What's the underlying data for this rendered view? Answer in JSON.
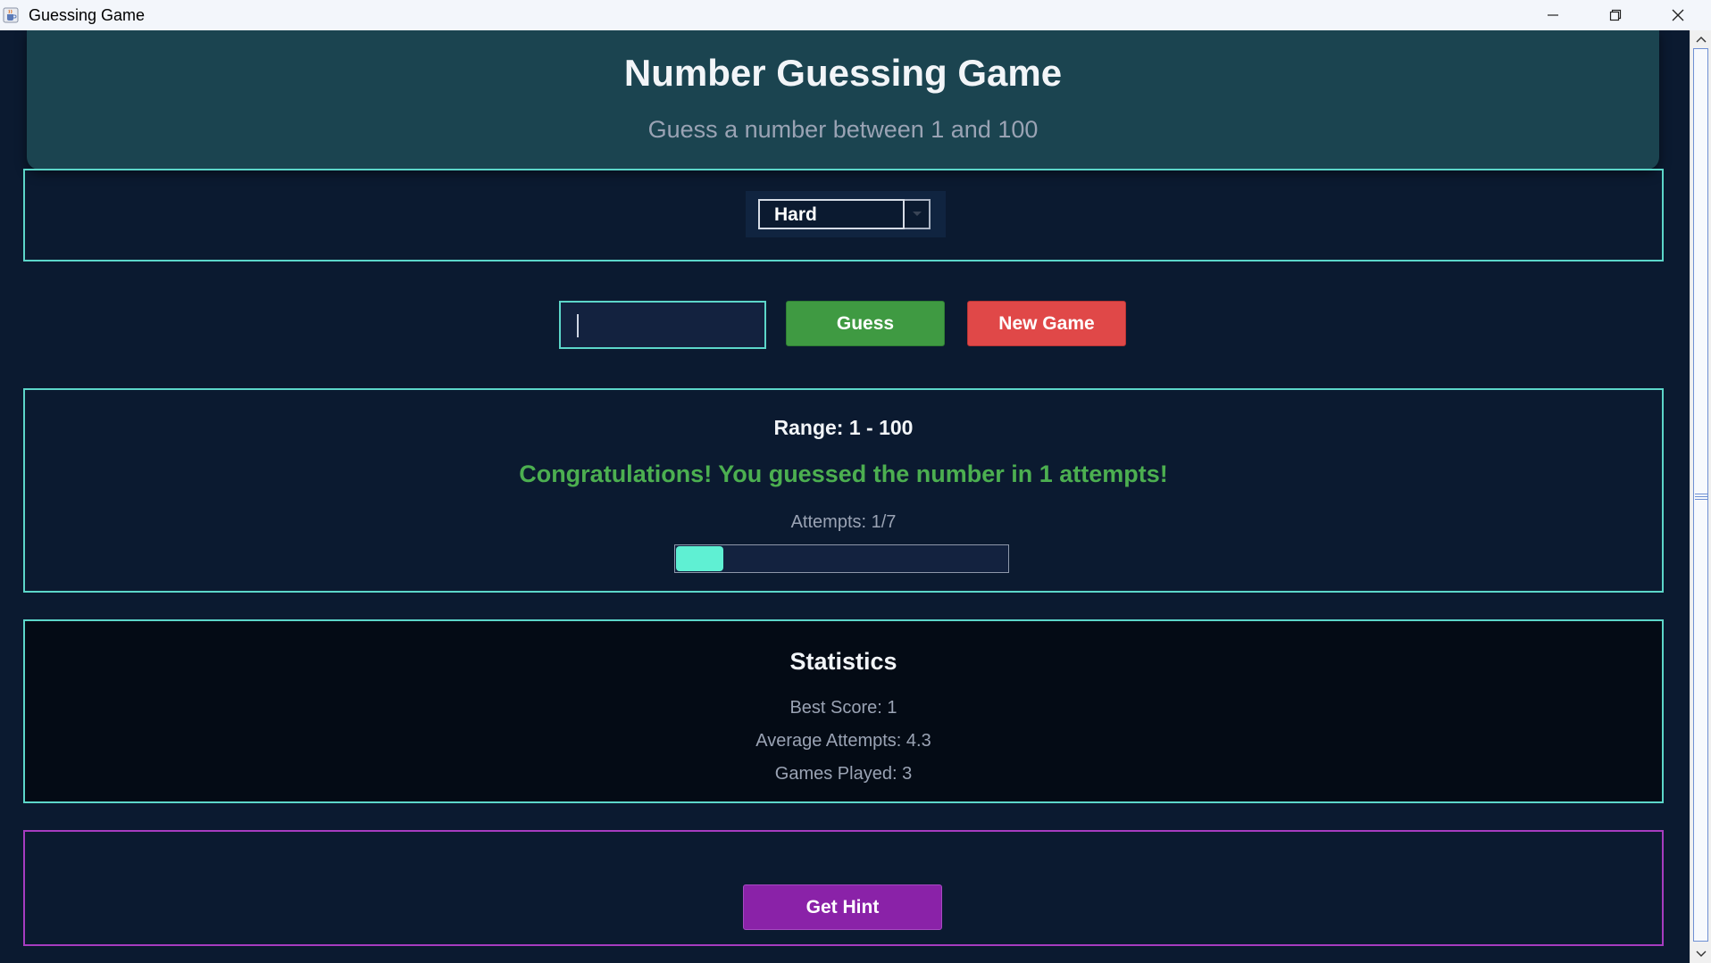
{
  "window": {
    "title": "Guessing Game",
    "icon": "java-cup-icon"
  },
  "header": {
    "title": "Number Guessing Game",
    "subtitle": "Guess a number between 1 and 100"
  },
  "difficulty": {
    "selected": "Hard"
  },
  "controls": {
    "guess_value": "",
    "guess_label": "Guess",
    "new_game_label": "New Game"
  },
  "status": {
    "range": "Range: 1 - 100",
    "message": "Congratulations! You guessed the number in 1 attempts!",
    "attempts": "Attempts: 1/7",
    "progress_fraction": 0.142857
  },
  "statistics": {
    "title": "Statistics",
    "best_score": "Best Score: 1",
    "average_attempts": "Average Attempts: 4.3",
    "games_played": "Games Played: 3"
  },
  "hint": {
    "label": "Get Hint"
  },
  "colors": {
    "background": "#0b1a30",
    "accent_teal": "#5cd6c9",
    "success_green": "#4caf50",
    "guess_button": "#3f9a42",
    "new_game_button": "#e04848",
    "hint_purple": "#8a22a8",
    "progress_fill": "#5ff0d3"
  }
}
